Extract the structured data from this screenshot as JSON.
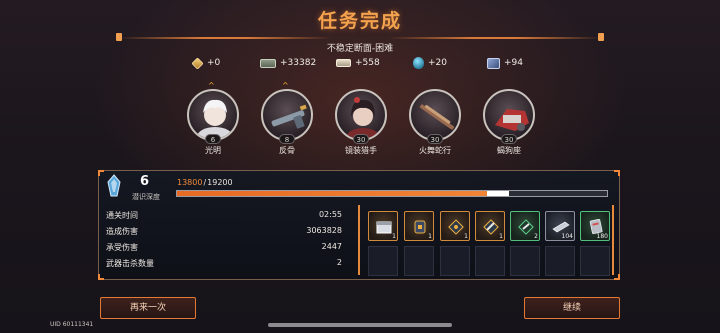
{
  "header": {
    "title": "任务完成",
    "subtitle": "不稳定断面-困难"
  },
  "rewards": [
    {
      "icon": "diamond-currency-icon",
      "amount": "+0"
    },
    {
      "icon": "cash-currency-icon",
      "amount": "+33382"
    },
    {
      "icon": "ticket-currency-icon",
      "amount": "+558"
    },
    {
      "icon": "blue-crystal-icon",
      "amount": "+20"
    },
    {
      "icon": "material-box-icon",
      "amount": "+94"
    }
  ],
  "characters": [
    {
      "name": "光明",
      "level": "6",
      "level_up": "^"
    },
    {
      "name": "反骨",
      "level": "8",
      "level_up": "^"
    },
    {
      "name": "镜装猎手",
      "level": "30"
    },
    {
      "name": "火舞蛇行",
      "level": "30"
    },
    {
      "name": "蝎狗座",
      "level": "30"
    }
  ],
  "depth": {
    "value": "6",
    "label": "潜识深度"
  },
  "exp": {
    "current": "13800",
    "separator": "/",
    "max": "19200",
    "progress_fraction": 0.72,
    "gain_fraction": 0.05
  },
  "stats": [
    {
      "label": "通关时间",
      "value": "02:55"
    },
    {
      "label": "造成伤害",
      "value": "3063828"
    },
    {
      "label": "承受伤害",
      "value": "2447"
    },
    {
      "label": "武器击杀数量",
      "value": "2"
    }
  ],
  "items": [
    {
      "icon": "supply-crate-icon",
      "count": "1",
      "rarity": "orange"
    },
    {
      "icon": "gold-badge-icon",
      "count": "1",
      "rarity": "orange"
    },
    {
      "icon": "chip-module-icon",
      "count": "1",
      "rarity": "orange"
    },
    {
      "icon": "weapon-module-icon",
      "count": "1",
      "rarity": "orange"
    },
    {
      "icon": "green-module-icon",
      "count": "2",
      "rarity": "green"
    },
    {
      "icon": "metal-plate-icon",
      "count": "104",
      "rarity": "gray"
    },
    {
      "icon": "data-card-icon",
      "count": "180",
      "rarity": "green"
    }
  ],
  "buttons": {
    "retry": "再来一次",
    "continue": "继续"
  },
  "uid": "UID 60111341",
  "colors": {
    "accent": "#f08436",
    "title": "#f3a24d",
    "exp_text": "#f08a3a"
  }
}
